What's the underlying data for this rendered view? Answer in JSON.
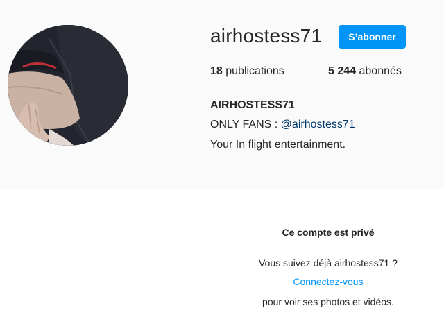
{
  "profile": {
    "username": "airhostess71",
    "follow_label": "S’abonner",
    "stats": {
      "posts_count": "18",
      "posts_label": "publications",
      "followers_count": "5 244",
      "followers_label": "abonnés"
    },
    "full_name": "AIRHOSTESS71",
    "bio": {
      "line1_prefix": "ONLY FANS : ",
      "line1_link": "@airhostess71",
      "line2": "Your In flight entertainment."
    },
    "avatar_icon": "profile-photo"
  },
  "private_notice": {
    "title": "Ce compte est privé",
    "question": "Vous suivez déjà airhostess71 ?",
    "login_link": "Connectez-vous",
    "subtitle": "pour voir ses photos et vidéos."
  },
  "colors": {
    "accent": "#0095f6",
    "header_bg": "#fafafa",
    "text": "#262626",
    "link_dark": "#00376b"
  }
}
